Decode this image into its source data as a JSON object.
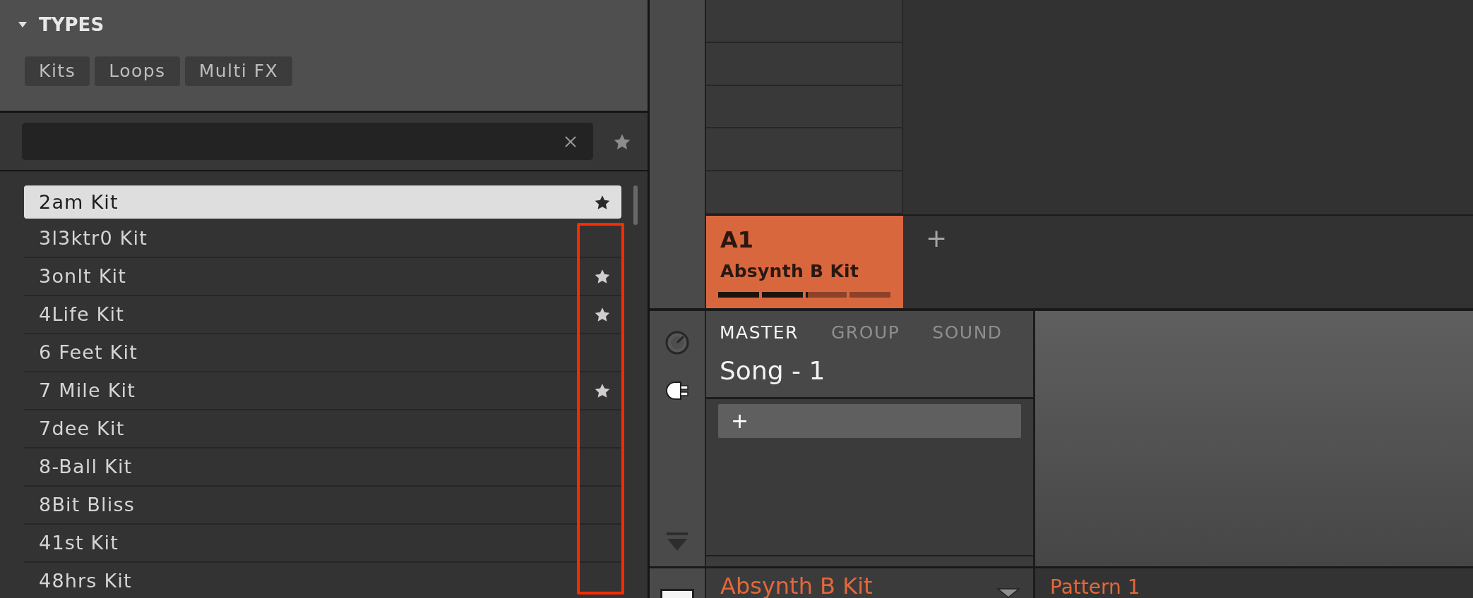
{
  "browser": {
    "types": {
      "label": "TYPES",
      "expanded": true,
      "tags": [
        {
          "label": "Kits"
        },
        {
          "label": "Loops"
        },
        {
          "label": "Multi FX"
        }
      ]
    },
    "results": [
      {
        "name": "2am Kit",
        "favorite": true,
        "selected": true
      },
      {
        "name": "3l3ktr0 Kit",
        "favorite": false,
        "selected": false
      },
      {
        "name": "3onlt Kit",
        "favorite": true,
        "selected": false
      },
      {
        "name": "4Life Kit",
        "favorite": true,
        "selected": false
      },
      {
        "name": "6 Feet Kit",
        "favorite": false,
        "selected": false
      },
      {
        "name": "7 Mile Kit",
        "favorite": true,
        "selected": false
      },
      {
        "name": "7dee Kit",
        "favorite": false,
        "selected": false
      },
      {
        "name": "8-Ball Kit",
        "favorite": false,
        "selected": false
      },
      {
        "name": "8Bit Bliss",
        "favorite": false,
        "selected": false
      },
      {
        "name": "41st Kit",
        "favorite": false,
        "selected": false
      },
      {
        "name": "48hrs Kit",
        "favorite": false,
        "selected": false
      }
    ]
  },
  "arranger": {
    "pattern": {
      "label": "A1",
      "name": "Absynth B Kit",
      "level": 0.52
    },
    "add_label": "+"
  },
  "mixer": {
    "tabs": [
      {
        "label": "MASTER",
        "selected": true
      },
      {
        "label": "GROUP",
        "selected": false
      },
      {
        "label": "SOUND",
        "selected": false
      }
    ],
    "title": "Song - 1",
    "add_label": "+"
  },
  "footer": {
    "group_name": "Absynth B Kit",
    "pattern_name": "Pattern 1"
  }
}
